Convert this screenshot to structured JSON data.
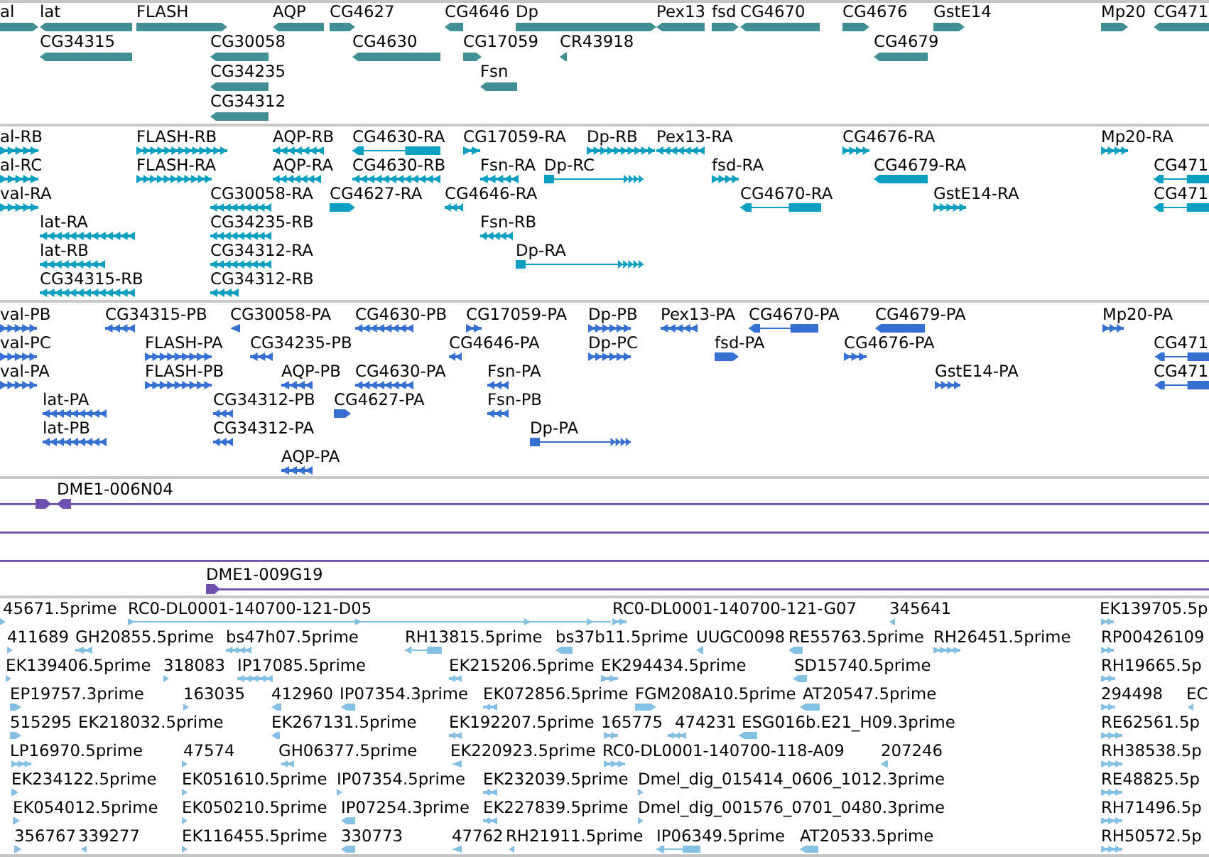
{
  "tracks": [
    {
      "kind": "gene",
      "features": [
        {
          "label": "al",
          "forward": true
        },
        {
          "label": "lat",
          "forward": false
        },
        {
          "label": "FLASH",
          "forward": true
        },
        {
          "label": "AQP",
          "forward": false
        },
        {
          "label": "CG4627",
          "forward": true
        },
        {
          "label": "CG4646",
          "forward": false
        },
        {
          "label": "Dp",
          "forward": true
        },
        {
          "label": "Pex13",
          "forward": false
        },
        {
          "label": "fsd",
          "forward": true
        },
        {
          "label": "CG4670",
          "forward": false
        },
        {
          "label": "CG4676",
          "forward": true
        },
        {
          "label": "GstE14",
          "forward": true
        },
        {
          "label": "Mp20",
          "forward": true
        },
        {
          "label": "CG471",
          "forward": false
        },
        {
          "label": "CG34315",
          "forward": false
        },
        {
          "label": "CG30058",
          "forward": false
        },
        {
          "label": "CG4630",
          "forward": false
        },
        {
          "label": "CG17059",
          "forward": true
        },
        {
          "label": "CR43918",
          "forward": false
        },
        {
          "label": "CG4679",
          "forward": false
        },
        {
          "label": "CG34235",
          "forward": false
        },
        {
          "label": "Fsn",
          "forward": false
        },
        {
          "label": "CG34312",
          "forward": false
        }
      ]
    },
    {
      "kind": "transcript",
      "features": [
        {
          "label": "al-RB",
          "forward": true
        },
        {
          "label": "FLASH-RB",
          "forward": true
        },
        {
          "label": "AQP-RB",
          "forward": false
        },
        {
          "label": "CG4630-RA",
          "forward": false
        },
        {
          "label": "CG17059-RA",
          "forward": true
        },
        {
          "label": "Dp-RB",
          "forward": true
        },
        {
          "label": "Pex13-RA",
          "forward": false
        },
        {
          "label": "CG4676-RA",
          "forward": true
        },
        {
          "label": "Mp20-RA",
          "forward": true
        },
        {
          "label": "al-RC",
          "forward": true
        },
        {
          "label": "FLASH-RA",
          "forward": true
        },
        {
          "label": "AQP-RA",
          "forward": false
        },
        {
          "label": "CG4630-RB",
          "forward": false
        },
        {
          "label": "Fsn-RA",
          "forward": false
        },
        {
          "label": "Dp-RC",
          "forward": true
        },
        {
          "label": "fsd-RA",
          "forward": true
        },
        {
          "label": "CG4679-RA",
          "forward": false
        },
        {
          "label": "CG471",
          "forward": false
        },
        {
          "label": "val-RA",
          "forward": true
        },
        {
          "label": "CG30058-RA",
          "forward": false
        },
        {
          "label": "CG4627-RA",
          "forward": true
        },
        {
          "label": "CG4646-RA",
          "forward": false
        },
        {
          "label": "CG4670-RA",
          "forward": false
        },
        {
          "label": "GstE14-RA",
          "forward": true
        },
        {
          "label": "CG471",
          "forward": false
        },
        {
          "label": "lat-RA",
          "forward": false
        },
        {
          "label": "CG34235-RB",
          "forward": false
        },
        {
          "label": "Fsn-RB",
          "forward": false
        },
        {
          "label": "lat-RB",
          "forward": false
        },
        {
          "label": "CG34312-RA",
          "forward": false
        },
        {
          "label": "Dp-RA",
          "forward": true
        },
        {
          "label": "CG34315-RB",
          "forward": false
        },
        {
          "label": "CG34312-RB",
          "forward": false
        }
      ]
    },
    {
      "kind": "protein",
      "features": [
        {
          "label": "val-PB",
          "forward": true
        },
        {
          "label": "CG34315-PB",
          "forward": false
        },
        {
          "label": "CG30058-PA",
          "forward": false
        },
        {
          "label": "CG4630-PB",
          "forward": false
        },
        {
          "label": "CG17059-PA",
          "forward": true
        },
        {
          "label": "Dp-PB",
          "forward": true
        },
        {
          "label": "Pex13-PA",
          "forward": false
        },
        {
          "label": "CG4670-PA",
          "forward": false
        },
        {
          "label": "CG4679-PA",
          "forward": false
        },
        {
          "label": "Mp20-PA",
          "forward": true
        },
        {
          "label": "val-PC",
          "forward": true
        },
        {
          "label": "FLASH-PA",
          "forward": true
        },
        {
          "label": "CG34235-PB",
          "forward": false
        },
        {
          "label": "CG4646-PA",
          "forward": false
        },
        {
          "label": "Dp-PC",
          "forward": true
        },
        {
          "label": "fsd-PA",
          "forward": true
        },
        {
          "label": "CG4676-PA",
          "forward": true
        },
        {
          "label": "CG471",
          "forward": false
        },
        {
          "label": "val-PA",
          "forward": true
        },
        {
          "label": "FLASH-PB",
          "forward": true
        },
        {
          "label": "AQP-PB",
          "forward": false
        },
        {
          "label": "CG4630-PA",
          "forward": false
        },
        {
          "label": "Fsn-PA",
          "forward": false
        },
        {
          "label": "GstE14-PA",
          "forward": true
        },
        {
          "label": "CG471",
          "forward": false
        },
        {
          "label": "lat-PA",
          "forward": false
        },
        {
          "label": "CG34312-PB",
          "forward": false
        },
        {
          "label": "CG4627-PA",
          "forward": true
        },
        {
          "label": "Fsn-PB",
          "forward": false
        },
        {
          "label": "lat-PB",
          "forward": false
        },
        {
          "label": "CG34312-PA",
          "forward": false
        },
        {
          "label": "Dp-PA",
          "forward": true
        },
        {
          "label": "AQP-PA",
          "forward": false
        }
      ]
    },
    {
      "kind": "clone",
      "features": [
        {
          "label": "DME1-006N04"
        },
        {
          "label": "DME1-009G19"
        }
      ]
    },
    {
      "kind": "est",
      "features": [
        {
          "label": "45671.5prime",
          "forward": true
        },
        {
          "label": "RC0-DL0001-140700-121-D05",
          "forward": true
        },
        {
          "label": "RC0-DL0001-140700-121-G07",
          "forward": true
        },
        {
          "label": "345641",
          "forward": false
        },
        {
          "label": "EK139705.5p",
          "forward": true
        },
        {
          "label": "411689",
          "forward": true
        },
        {
          "label": "GH20855.5prime",
          "forward": false
        },
        {
          "label": "bs47h07.5prime",
          "forward": false
        },
        {
          "label": "RH13815.5prime",
          "forward": false
        },
        {
          "label": "bs37b11.5prime",
          "forward": false
        },
        {
          "label": "UUGC0098",
          "forward": false
        },
        {
          "label": "RE55763.5prime",
          "forward": false
        },
        {
          "label": "RH26451.5prime",
          "forward": true
        },
        {
          "label": "RP00426109",
          "forward": true
        },
        {
          "label": "EK139406.5prime",
          "forward": true
        },
        {
          "label": "318083",
          "forward": true
        },
        {
          "label": "IP17085.5prime",
          "forward": false
        },
        {
          "label": "EK215206.5prime",
          "forward": false
        },
        {
          "label": "EK294434.5prime",
          "forward": true
        },
        {
          "label": "SD15740.5prime",
          "forward": false
        },
        {
          "label": "RH19665.5p",
          "forward": true
        },
        {
          "label": "EP19757.3prime",
          "forward": true
        },
        {
          "label": "163035",
          "forward": true
        },
        {
          "label": "412960",
          "forward": false
        },
        {
          "label": "IP07354.3prime",
          "forward": false
        },
        {
          "label": "EK072856.5prime",
          "forward": false
        },
        {
          "label": "FGM208A10.5prime",
          "forward": true
        },
        {
          "label": "AT20547.5prime",
          "forward": false
        },
        {
          "label": "294498",
          "forward": true
        },
        {
          "label": "EC",
          "forward": false
        },
        {
          "label": "515295",
          "forward": true
        },
        {
          "label": "EK218032.5prime"
        },
        {
          "label": "EK267131.5prime",
          "forward": false
        },
        {
          "label": "EK192207.5prime",
          "forward": false
        },
        {
          "label": "165775",
          "forward": true
        },
        {
          "label": "474231",
          "forward": false
        },
        {
          "label": "ESG016b.E21_H09.3prime",
          "forward": false
        },
        {
          "label": "RE62561.5p",
          "forward": true
        },
        {
          "label": "LP16970.5prime",
          "forward": true
        },
        {
          "label": "47574",
          "forward": true
        },
        {
          "label": "GH06377.5prime",
          "forward": false
        },
        {
          "label": "EK220923.5prime",
          "forward": false
        },
        {
          "label": "RC0-DL0001-140700-118-A09",
          "forward": true
        },
        {
          "label": "207246",
          "forward": false
        },
        {
          "label": "RH38538.5p",
          "forward": true
        },
        {
          "label": "EK234122.5prime",
          "forward": true
        },
        {
          "label": "EK051610.5prime",
          "forward": true
        },
        {
          "label": "IP07354.5prime",
          "forward": true
        },
        {
          "label": "EK232039.5prime",
          "forward": false
        },
        {
          "label": "Dmel_dig_015414_0606_1012.3prime",
          "forward": true
        },
        {
          "label": "RE48825.5p",
          "forward": true
        },
        {
          "label": "EK054012.5prime",
          "forward": true
        },
        {
          "label": "EK050210.5prime",
          "forward": true
        },
        {
          "label": "IP07254.3prime",
          "forward": false
        },
        {
          "label": "EK227839.5prime",
          "forward": false
        },
        {
          "label": "Dmel_dig_001576_0701_0480.3prime",
          "forward": true
        },
        {
          "label": "RH71496.5p",
          "forward": true
        },
        {
          "label": "356767",
          "forward": true
        },
        {
          "label": "339277",
          "forward": false
        },
        {
          "label": "EK116455.5prime",
          "forward": true
        },
        {
          "label": "330773",
          "forward": false
        },
        {
          "label": "47762",
          "forward": false
        },
        {
          "label": "RH21911.5prime",
          "forward": false
        },
        {
          "label": "IP06349.5prime",
          "forward": false
        },
        {
          "label": "AT20533.5prime",
          "forward": false
        },
        {
          "label": "RH50572.5p",
          "forward": true
        }
      ]
    }
  ]
}
